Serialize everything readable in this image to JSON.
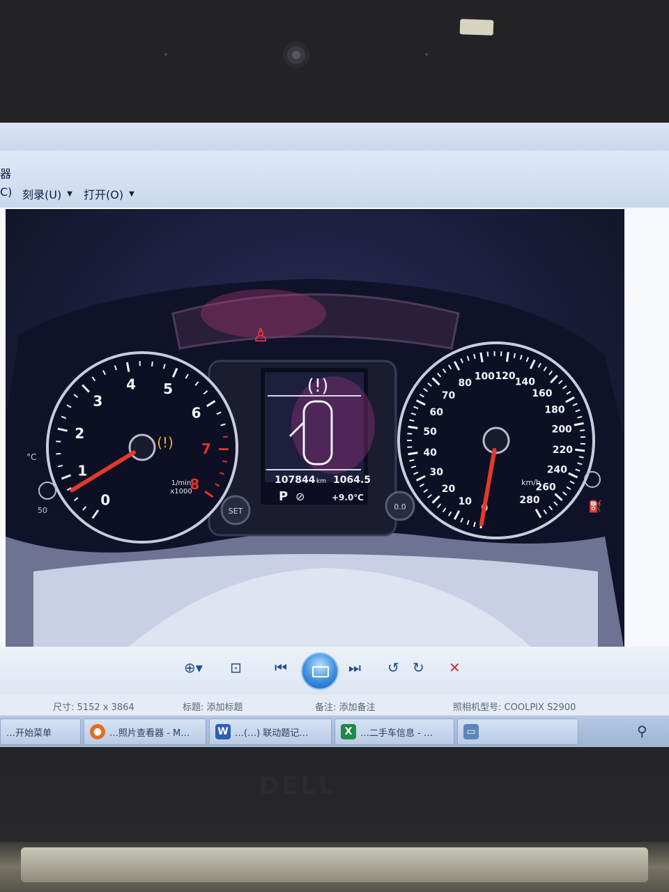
{
  "window": {
    "menu_clip_left": "C)",
    "menu_burn": "刻录(U)",
    "menu_open": "打开(O)"
  },
  "dashboard": {
    "tach_numbers": [
      "0",
      "1",
      "2",
      "3",
      "4",
      "5",
      "6",
      "7",
      "8"
    ],
    "tach_unit_1": "1/min",
    "tach_unit_2": "x1000",
    "speed_numbers": [
      "0",
      "10",
      "20",
      "30",
      "40",
      "50",
      "60",
      "70",
      "80",
      "100",
      "120",
      "140",
      "160",
      "180",
      "200",
      "220",
      "240",
      "260",
      "280"
    ],
    "speed_unit": "km/h",
    "odometer": "107844",
    "odometer_unit": "km",
    "trip": "1064.5",
    "gear": "P",
    "outside_temp": "+9.0℃",
    "button_set": "SET",
    "button_reset": "0.0",
    "temp_gauge_label": "°C",
    "temp_gauge_value": "50",
    "tach_needle_rpm": 0.7,
    "speed_needle_kmh": 0
  },
  "toolbar": {
    "zoom_icon": "zoom-icon",
    "fit_icon": "fit-icon",
    "prev_icon": "previous-icon",
    "play_icon": "slideshow-icon",
    "next_icon": "next-icon",
    "rotate_left_icon": "rotate-left-icon",
    "rotate_right_icon": "rotate-right-icon",
    "delete_icon": "delete-icon"
  },
  "info": {
    "size_label": "尺寸:",
    "size_value": "5152 x 3864",
    "title_label": "标题:",
    "title_value": "添加标题",
    "note_label": "备注:",
    "note_value": "添加备注",
    "camera_label": "照相机型号:",
    "camera_value": "COOLPIX S2900"
  },
  "taskbar": {
    "items": [
      {
        "label": "…开始菜单"
      },
      {
        "label": "…照片查看器 - M…"
      },
      {
        "label": "…(…) 联动题记…"
      },
      {
        "label": "…二手车信息 - …"
      },
      {
        "label": ""
      }
    ]
  },
  "laptop": {
    "brand": "DELL"
  },
  "colors": {
    "needle": "#e23a2a",
    "redline": "#e0332a",
    "warning_amber": "#f4b020",
    "screen_bg": "#1a1d3a"
  }
}
